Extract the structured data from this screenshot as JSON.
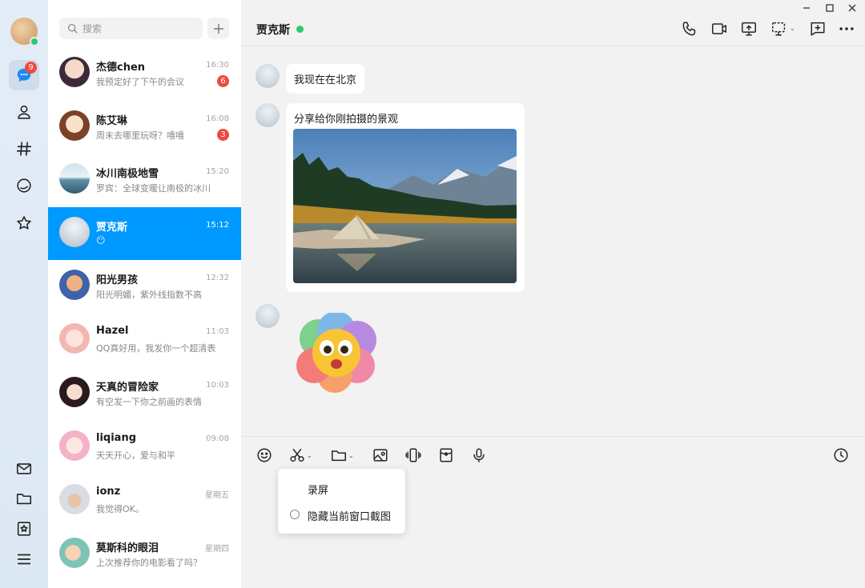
{
  "rail": {
    "chat_badge": "9",
    "colors": {
      "online": "#2ccb6a",
      "accent": "#0099ff",
      "badge": "#f0493e"
    }
  },
  "sidebar": {
    "search_placeholder": "搜索",
    "conversations": [
      {
        "name": "杰德chen",
        "time": "16:30",
        "preview": "我预定好了下午的会议",
        "unread": "6"
      },
      {
        "name": "陈艾琳",
        "time": "16:08",
        "preview": "周末去哪里玩呀？嘻嘻",
        "unread": "3"
      },
      {
        "name": "冰川南极地雪",
        "time": "15:20",
        "preview": "罗宾：全球变暖让南极的冰川",
        "unread": ""
      },
      {
        "name": "贾克斯",
        "time": "15:12",
        "preview": "😶",
        "unread": ""
      },
      {
        "name": "阳光男孩",
        "time": "12:32",
        "preview": "阳光明媚，紫外线指数不高",
        "unread": ""
      },
      {
        "name": "Hazel",
        "time": "11:03",
        "preview": "QQ真好用，我发你一个超清表情",
        "unread": ""
      },
      {
        "name": "天真的冒险家",
        "time": "10:03",
        "preview": "有空发一下你之前画的表情",
        "unread": ""
      },
      {
        "name": "liqiang",
        "time": "09:08",
        "preview": "天天开心，爱与和平",
        "unread": ""
      },
      {
        "name": "ionz",
        "time": "星期五",
        "preview": "我觉得OK。",
        "unread": ""
      },
      {
        "name": "莫斯科的眼泪",
        "time": "星期四",
        "preview": "上次推荐你的电影看了吗？",
        "unread": ""
      }
    ]
  },
  "chat": {
    "title": "贾克斯",
    "messages": [
      {
        "text": "我现在在北京"
      },
      {
        "text": "分享给你刚拍摄的景观"
      }
    ]
  },
  "popup": {
    "item1": "录屏",
    "item2": "隐藏当前窗口截图"
  }
}
